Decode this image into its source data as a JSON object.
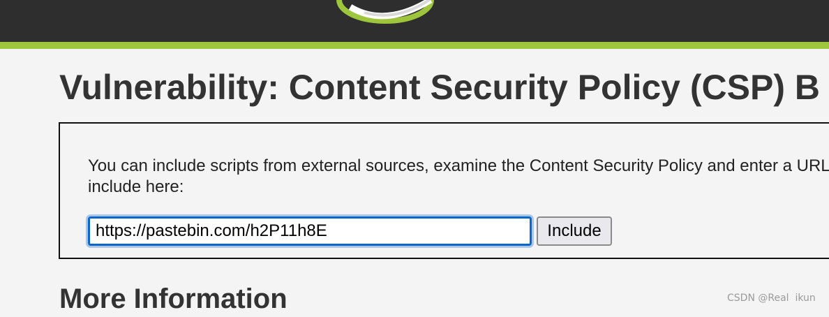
{
  "header": {
    "logo_icon": "dvwa-swoosh-logo-icon",
    "stripe_color": "#9ec63c",
    "background_color": "#2e2e2e"
  },
  "page": {
    "title": "Vulnerability: Content Security Policy (CSP) B",
    "instructions": "You can include scripts from external sources, examine the Content Security Policy and enter a URL to include here:",
    "url_input_value": "https://pastebin.com/h2P11h8E",
    "include_button_label": "Include",
    "more_info_heading": "More Information"
  },
  "watermark": {
    "text": "CSDN @Real  ikun"
  }
}
